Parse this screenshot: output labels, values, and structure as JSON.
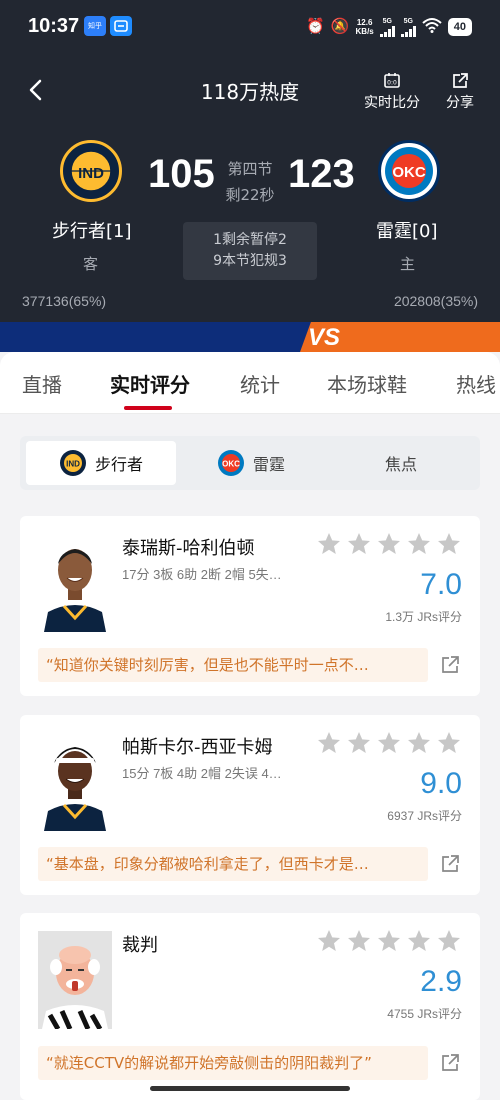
{
  "status_bar": {
    "time": "10:37",
    "badge_text": "知乎",
    "net_speed_value": "12.6",
    "net_speed_unit": "KB/s",
    "sim1": "5G",
    "sim2": "5G",
    "battery": "40",
    "icons": [
      "alarm-icon",
      "mute-icon",
      "wifi-icon"
    ]
  },
  "header": {
    "title": "118万热度",
    "live_score_label": "实时比分",
    "share_label": "分享"
  },
  "game": {
    "period": "第四节",
    "clock": "剩22秒",
    "away": {
      "abbr": "IND",
      "name": "步行者[1]",
      "role": "客",
      "score": "105",
      "heat": "377136(65%)",
      "color": "#0c2340",
      "accent": "#fdbb30"
    },
    "home": {
      "abbr": "OKC",
      "name": "雷霆[0]",
      "role": "主",
      "score": "123",
      "heat": "202808(35%)",
      "color": "#007ac1",
      "accent": "#ef3b24"
    },
    "info_line1": "1剩余暂停2",
    "info_line2": "9本节犯规3",
    "vs_text": "VS"
  },
  "tabs": [
    "直播",
    "实时评分",
    "统计",
    "本场球鞋",
    "热线"
  ],
  "active_tab": "实时评分",
  "segments": {
    "pacers": "步行者",
    "thunder": "雷霆",
    "focus": "焦点"
  },
  "ratings": [
    {
      "name": "泰瑞斯-哈利伯顿",
      "stats": "17分 3板 6助 2断 2帽 5失…",
      "score": "7.0",
      "count": "1.3万 JRs评分",
      "comment": "“知道你关键时刻厉害，但是也不能平时一点不…"
    },
    {
      "name": "帕斯卡尔-西亚卡姆",
      "stats": "15分 7板 4助 2帽 2失误 4…",
      "score": "9.0",
      "count": "6937 JRs评分",
      "comment": "“基本盘，印象分都被哈利拿走了，但西卡才是…"
    },
    {
      "name": "裁判",
      "stats": "",
      "score": "2.9",
      "count": "4755 JRs评分",
      "comment": "“就连CCTV的解说都开始旁敲侧击的阴阳裁判了”"
    }
  ],
  "colors": {
    "header_bg": "#222731",
    "accent_red": "#d0021b",
    "score_blue": "#2f8fd4",
    "comment_text": "#d0742a",
    "vs_blue": "#0d2d7a",
    "vs_orange": "#ef6b1d"
  }
}
